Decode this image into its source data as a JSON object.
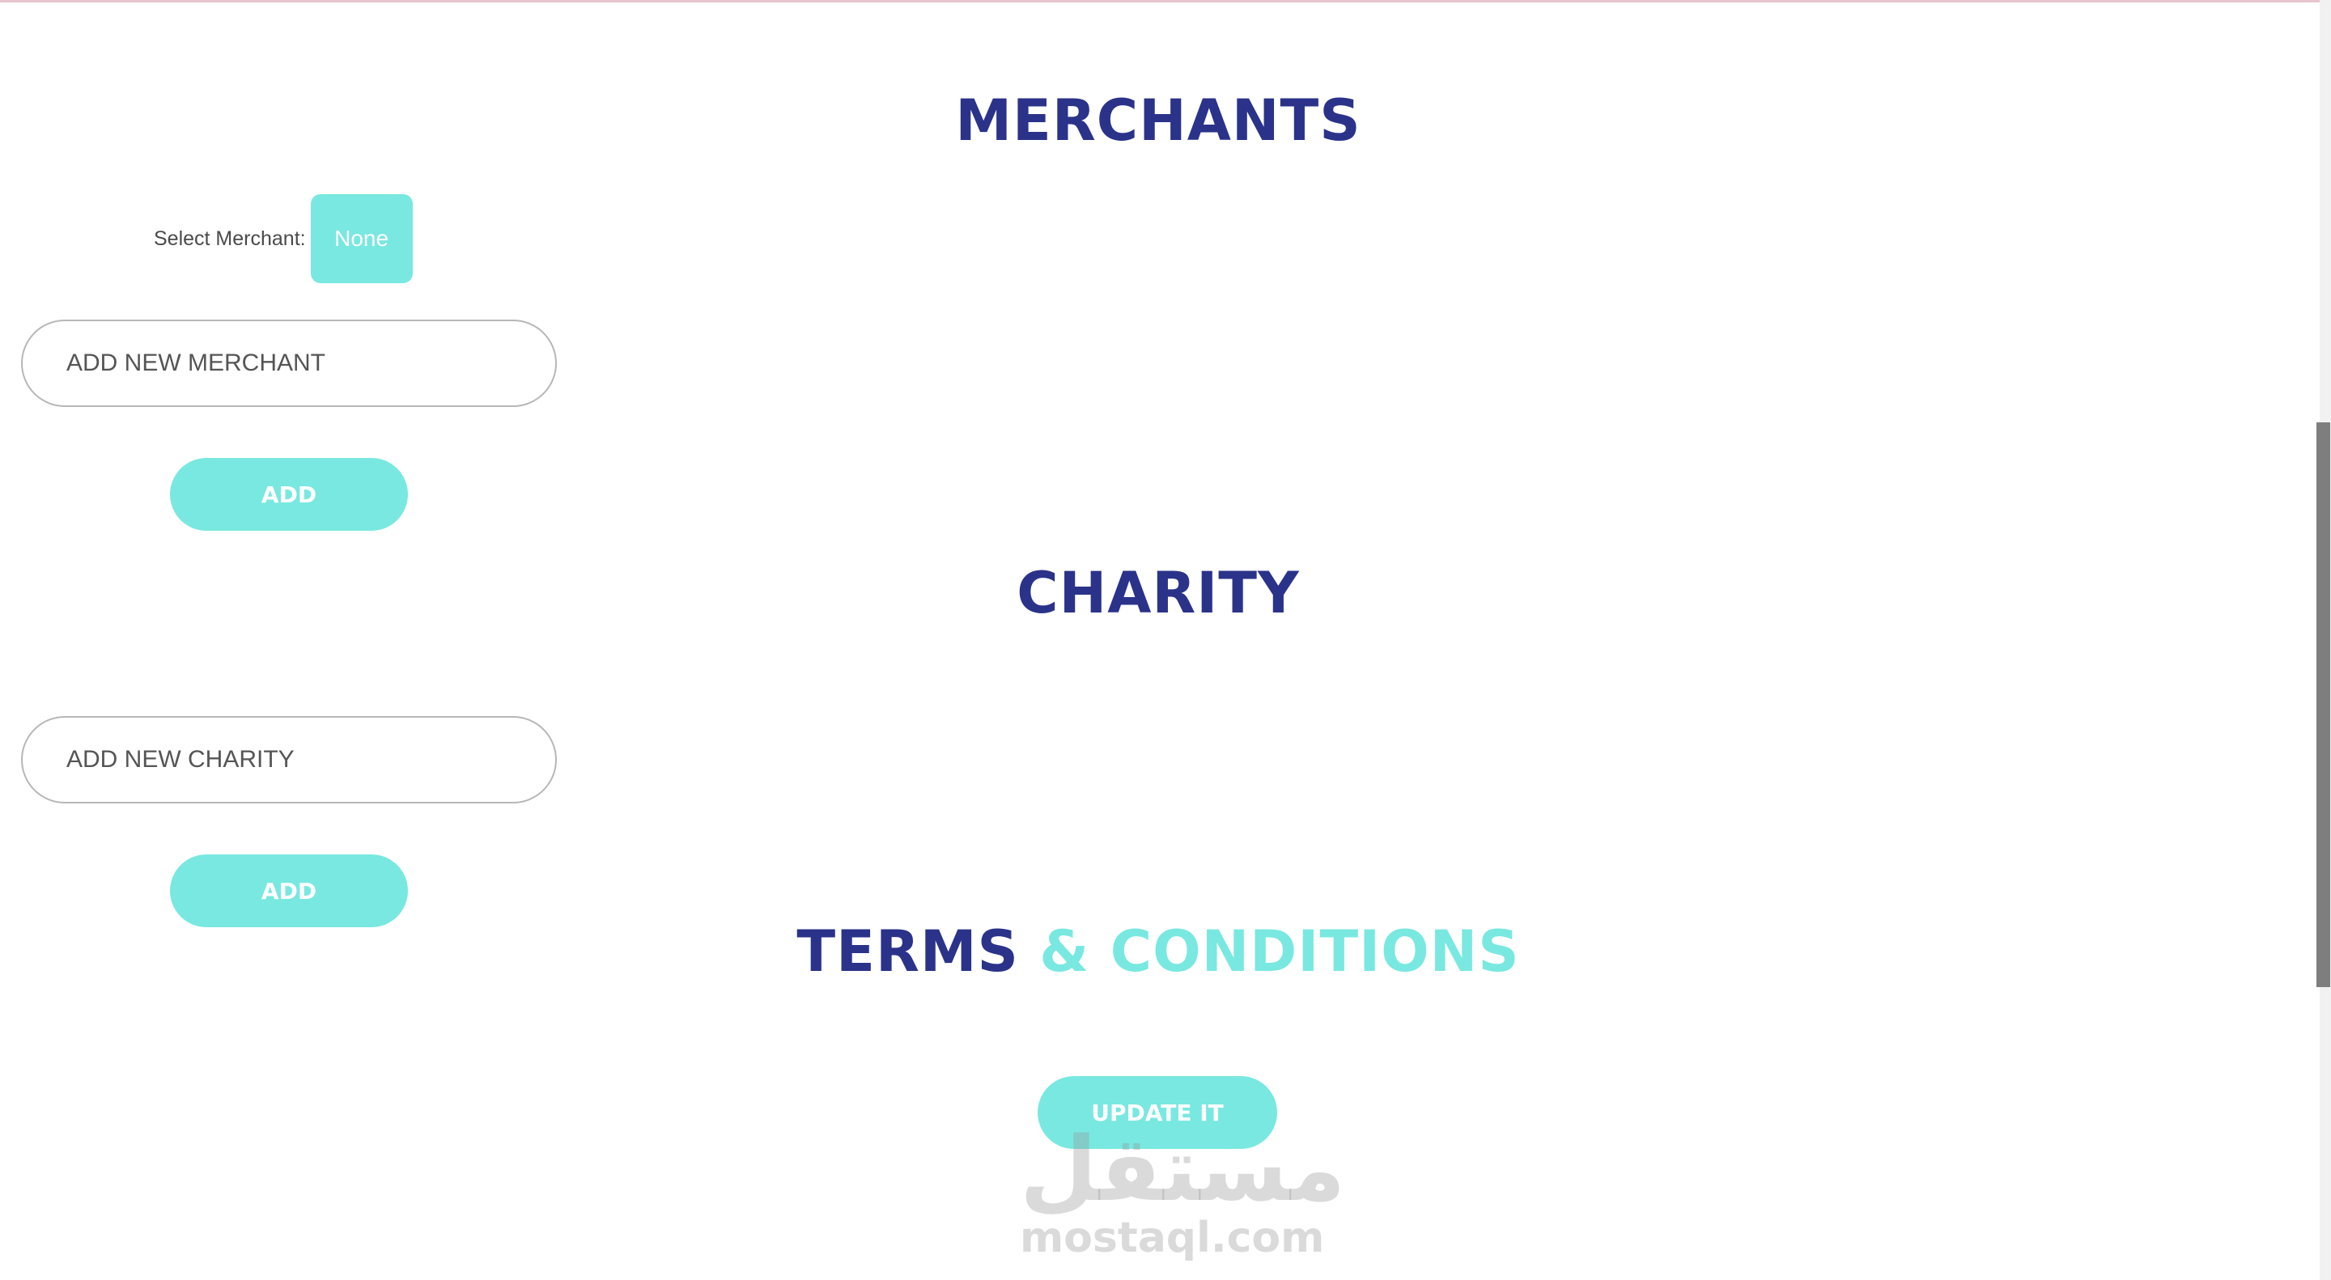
{
  "colors": {
    "navy": "#2b3289",
    "accent": "#79e8e0",
    "top_line": "#e8c4cc"
  },
  "merchants": {
    "heading": "MERCHANTS",
    "select_label": "Select Merchant:",
    "select_value": "None",
    "input_placeholder": "ADD NEW MERCHANT",
    "add_label": "ADD"
  },
  "charity": {
    "heading": "CHARITY",
    "input_placeholder": "ADD NEW CHARITY",
    "add_label": "ADD"
  },
  "terms": {
    "heading_part1": "TERMS",
    "heading_part2": "& CONDITIONS",
    "update_label": "UPDATE IT"
  },
  "watermark": {
    "arabic": "مستقل",
    "latin": "mostaql.com"
  }
}
